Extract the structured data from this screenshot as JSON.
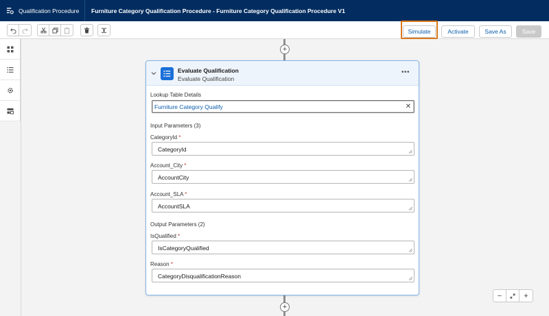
{
  "header": {
    "app_name": "Qualification Procedure",
    "title": "Furniture Category Qualification Procedure - Furniture Category Qualification Procedure V1"
  },
  "toolbar": {
    "simulate_label": "Simulate",
    "activate_label": "Activate",
    "save_as_label": "Save As",
    "save_label": "Save",
    "icons": [
      "undo-icon",
      "redo-icon",
      "cut-icon",
      "copy-icon",
      "paste-icon",
      "delete-icon",
      "align-icon"
    ]
  },
  "rail": {
    "icons": [
      "components-icon",
      "list-icon",
      "settings-icon",
      "resources-icon"
    ]
  },
  "step": {
    "title": "Evaluate Qualification",
    "subtitle": "Evaluate Qualification",
    "lookup_label": "Lookup Table Details",
    "lookup_value": "Furniture Category Qualify",
    "input_section": "Input Parameters (3)",
    "inputs": [
      {
        "label": "CategoryId",
        "value": "CategoryId"
      },
      {
        "label": "Account_City",
        "value": "AccountCity"
      },
      {
        "label": "Account_SLA",
        "value": "AccountSLA"
      }
    ],
    "output_section": "Output Parameters (2)",
    "outputs": [
      {
        "label": "IsQualified",
        "value": "IsCategoryQualified"
      },
      {
        "label": "Reason",
        "value": "CategoryDisqualificationReason"
      }
    ]
  },
  "colors": {
    "header_bg": "#032d60",
    "accent": "#0b5cab",
    "highlight": "#d9781c",
    "required": "#c23934"
  }
}
